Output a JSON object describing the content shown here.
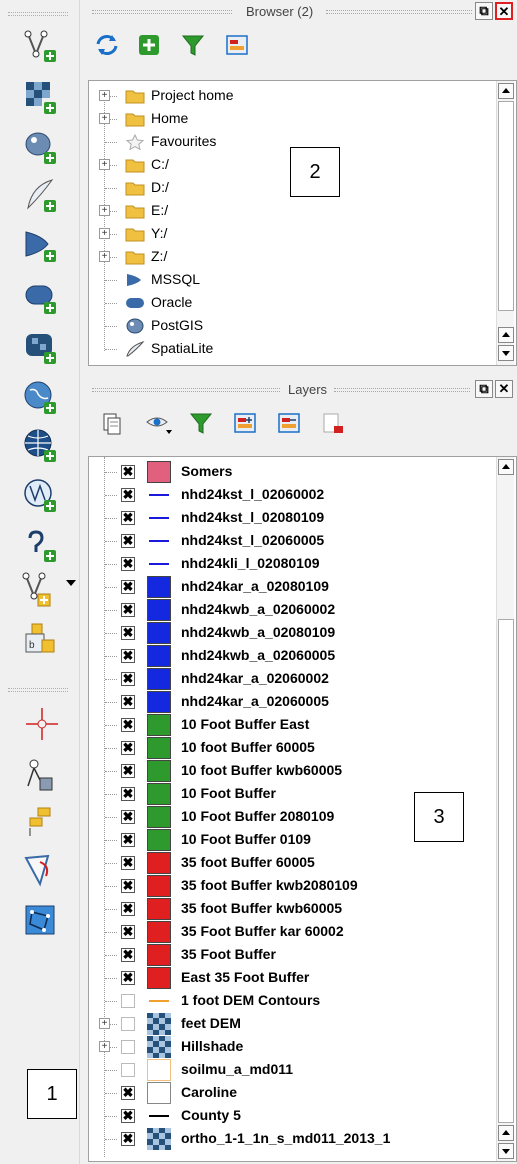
{
  "browser_panel": {
    "title": "Browser (2)",
    "items": [
      {
        "label": "Project home",
        "icon": "folder-icon",
        "expandable": true
      },
      {
        "label": "Home",
        "icon": "folder-icon",
        "expandable": true
      },
      {
        "label": "Favourites",
        "icon": "star-icon",
        "expandable": false
      },
      {
        "label": "C:/",
        "icon": "folder-icon",
        "expandable": true
      },
      {
        "label": "D:/",
        "icon": "folder-icon",
        "expandable": false
      },
      {
        "label": "E:/",
        "icon": "folder-icon",
        "expandable": true
      },
      {
        "label": "Y:/",
        "icon": "folder-icon",
        "expandable": true
      },
      {
        "label": "Z:/",
        "icon": "folder-icon",
        "expandable": true
      },
      {
        "label": "MSSQL",
        "icon": "mssql-icon",
        "expandable": false
      },
      {
        "label": "Oracle",
        "icon": "oracle-icon",
        "expandable": false
      },
      {
        "label": "PostGIS",
        "icon": "postgis-icon",
        "expandable": false
      },
      {
        "label": "SpatiaLite",
        "icon": "spatialite-icon",
        "expandable": false
      }
    ]
  },
  "layers_panel": {
    "title": "Layers",
    "layers": [
      {
        "name": "Somers",
        "checked": true,
        "symbol": "fill",
        "color": "#e0607e"
      },
      {
        "name": "nhd24kst_l_02060002",
        "checked": true,
        "symbol": "line",
        "color": "#1a1adc"
      },
      {
        "name": "nhd24kst_l_02080109",
        "checked": true,
        "symbol": "line",
        "color": "#1a1adc"
      },
      {
        "name": "nhd24kst_l_02060005",
        "checked": true,
        "symbol": "line",
        "color": "#1a1adc"
      },
      {
        "name": "nhd24kli_l_02080109",
        "checked": true,
        "symbol": "line",
        "color": "#1a1adc"
      },
      {
        "name": "nhd24kar_a_02080109",
        "checked": true,
        "symbol": "fill",
        "color": "#1428e0"
      },
      {
        "name": "nhd24kwb_a_02060002",
        "checked": true,
        "symbol": "fill",
        "color": "#1428e0"
      },
      {
        "name": "nhd24kwb_a_02080109",
        "checked": true,
        "symbol": "fill",
        "color": "#1428e0"
      },
      {
        "name": "nhd24kwb_a_02060005",
        "checked": true,
        "symbol": "fill",
        "color": "#1428e0"
      },
      {
        "name": "nhd24kar_a_02060002",
        "checked": true,
        "symbol": "fill",
        "color": "#1428e0"
      },
      {
        "name": "nhd24kar_a_02060005",
        "checked": true,
        "symbol": "fill",
        "color": "#1428e0"
      },
      {
        "name": "10 Foot Buffer East",
        "checked": true,
        "symbol": "fill",
        "color": "#2e9a2e"
      },
      {
        "name": "10 foot Buffer 60005",
        "checked": true,
        "symbol": "fill",
        "color": "#2e9a2e"
      },
      {
        "name": "10 foot Buffer kwb60005",
        "checked": true,
        "symbol": "fill",
        "color": "#2e9a2e"
      },
      {
        "name": "10 Foot Buffer",
        "checked": true,
        "symbol": "fill",
        "color": "#2e9a2e"
      },
      {
        "name": "10 Foot Buffer 2080109",
        "checked": true,
        "symbol": "fill",
        "color": "#2e9a2e"
      },
      {
        "name": "10 Foot Buffer 0109",
        "checked": true,
        "symbol": "fill",
        "color": "#2e9a2e"
      },
      {
        "name": "35 foot Buffer 60005",
        "checked": true,
        "symbol": "fill",
        "color": "#e02020"
      },
      {
        "name": "35 foot Buffer kwb2080109",
        "checked": true,
        "symbol": "fill",
        "color": "#e02020"
      },
      {
        "name": "35 foot Buffer kwb60005",
        "checked": true,
        "symbol": "fill",
        "color": "#e02020"
      },
      {
        "name": "35 Foot Buffer kar 60002",
        "checked": true,
        "symbol": "fill",
        "color": "#e02020"
      },
      {
        "name": "35 Foot Buffer",
        "checked": true,
        "symbol": "fill",
        "color": "#e02020"
      },
      {
        "name": "East 35 Foot Buffer",
        "checked": true,
        "symbol": "fill",
        "color": "#e02020"
      },
      {
        "name": "1 foot DEM Contours",
        "checked": false,
        "symbol": "line",
        "color": "#f0a030"
      },
      {
        "name": "feet DEM",
        "checked": false,
        "symbol": "raster",
        "color": "#2a5a8a",
        "expandable": true
      },
      {
        "name": "Hillshade",
        "checked": false,
        "symbol": "raster",
        "color": "#2a5a8a",
        "expandable": true
      },
      {
        "name": "soilmu_a_md011",
        "checked": false,
        "symbol": "outline",
        "color": "#f0c080"
      },
      {
        "name": "Caroline",
        "checked": true,
        "symbol": "outline",
        "color": "#888888"
      },
      {
        "name": "County 5",
        "checked": true,
        "symbol": "line",
        "color": "#000000"
      },
      {
        "name": "ortho_1-1_1n_s_md011_2013_1",
        "checked": true,
        "symbol": "raster",
        "color": "#2a5a8a"
      }
    ]
  },
  "callouts": {
    "one": "1",
    "two": "2",
    "three": "3"
  },
  "colors": {
    "accent_blue": "#1a6fc8",
    "green": "#2e9a2e",
    "close_highlight": "#e02020"
  }
}
